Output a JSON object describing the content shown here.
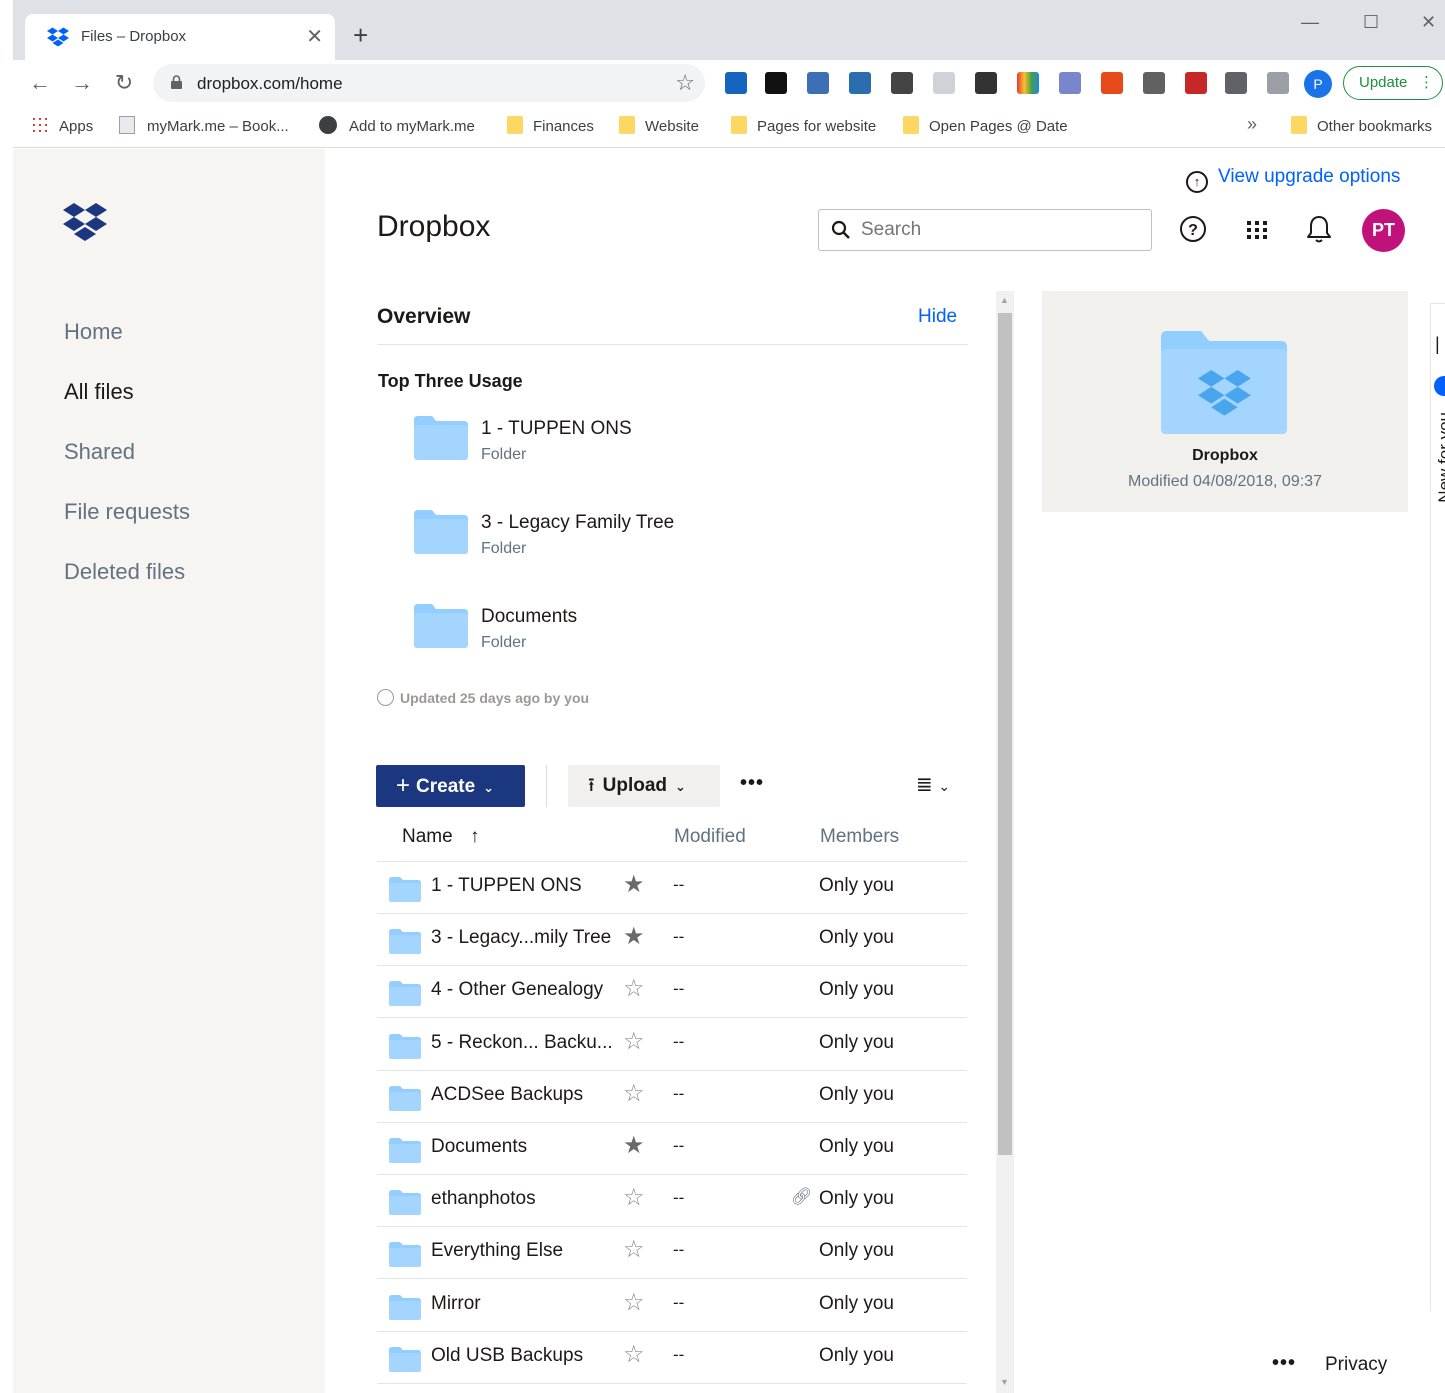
{
  "browser": {
    "tab_title": "Files – Dropbox",
    "url": "dropbox.com/home",
    "update_label": "Update",
    "profile_initial": "P",
    "bookmarks": [
      {
        "label": "Apps"
      },
      {
        "label": "myMark.me – Book..."
      },
      {
        "label": "Add to myMark.me"
      },
      {
        "label": "Finances"
      },
      {
        "label": "Website"
      },
      {
        "label": "Pages for website"
      },
      {
        "label": "Open Pages @ Date"
      },
      {
        "label": "Other bookmarks"
      }
    ],
    "overflow_label": "»"
  },
  "sidebar": {
    "items": [
      {
        "label": "Home"
      },
      {
        "label": "All files"
      },
      {
        "label": "Shared"
      },
      {
        "label": "File requests"
      },
      {
        "label": "Deleted files"
      }
    ],
    "active": "All files"
  },
  "header": {
    "upgrade_label": "View upgrade options",
    "title": "Dropbox",
    "search_placeholder": "Search",
    "avatar_initials": "PT"
  },
  "overview": {
    "title": "Overview",
    "hide_label": "Hide",
    "usage_title": "Top Three Usage",
    "items": [
      {
        "name": "1 - TUPPEN ONS",
        "type": "Folder"
      },
      {
        "name": "3 - Legacy Family Tree",
        "type": "Folder"
      },
      {
        "name": "Documents",
        "type": "Folder"
      }
    ],
    "updated_text": "Updated 25 days ago by you"
  },
  "actions": {
    "create_label": "Create",
    "upload_label": "Upload",
    "more_label": "•••"
  },
  "table": {
    "headers": {
      "name": "Name",
      "modified": "Modified",
      "members": "Members"
    },
    "sort_indicator": "↑",
    "rows": [
      {
        "name": "1 - TUPPEN ONS",
        "starred": true,
        "modified": "--",
        "members": "Only you",
        "shared_link": false
      },
      {
        "name": "3 - Legacy...mily Tree",
        "starred": true,
        "modified": "--",
        "members": "Only you",
        "shared_link": false
      },
      {
        "name": "4 - Other Genealogy",
        "starred": false,
        "modified": "--",
        "members": "Only you",
        "shared_link": false
      },
      {
        "name": "5 - Reckon... Backu...",
        "starred": false,
        "modified": "--",
        "members": "Only you",
        "shared_link": false
      },
      {
        "name": "ACDSee Backups",
        "starred": false,
        "modified": "--",
        "members": "Only you",
        "shared_link": false
      },
      {
        "name": "Documents",
        "starred": true,
        "modified": "--",
        "members": "Only you",
        "shared_link": false
      },
      {
        "name": "ethanphotos",
        "starred": false,
        "modified": "--",
        "members": "Only you",
        "shared_link": true
      },
      {
        "name": "Everything Else",
        "starred": false,
        "modified": "--",
        "members": "Only you",
        "shared_link": false
      },
      {
        "name": "Mirror",
        "starred": false,
        "modified": "--",
        "members": "Only you",
        "shared_link": false
      },
      {
        "name": "Old USB Backups",
        "starred": false,
        "modified": "--",
        "members": "Only you",
        "shared_link": false
      }
    ]
  },
  "preview": {
    "name": "Dropbox",
    "modified": "Modified 04/08/2018, 09:37"
  },
  "side_panel": {
    "label": "New for you"
  },
  "footer": {
    "more_label": "•••",
    "privacy_label": "Privacy"
  },
  "colors": {
    "brand_blue": "#0061fe",
    "create_button": "#1b3780",
    "folder_blue": "#92ceff",
    "avatar": "#c1117a",
    "sidebar_bg": "#f7f5f2"
  }
}
